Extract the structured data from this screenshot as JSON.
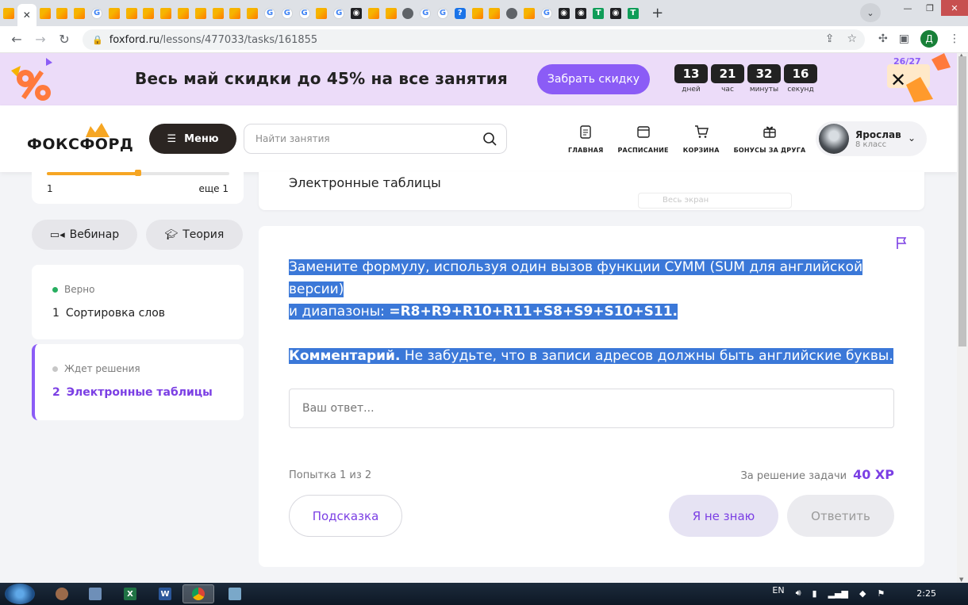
{
  "browser": {
    "tabs": [
      "fox",
      "fox",
      "fox",
      "g",
      "fox",
      "fox",
      "fox",
      "fox",
      "fox",
      "fox",
      "fox",
      "fox",
      "fox",
      "g",
      "g",
      "g",
      "fox",
      "g",
      "dark",
      "fox",
      "fox",
      "globe",
      "g",
      "g",
      "blue",
      "fox",
      "fox",
      "globe",
      "fox",
      "g",
      "dark",
      "dark",
      "green",
      "dark",
      "green"
    ],
    "url_host": "foxford.ru",
    "url_path": "/lessons/477033/tasks/161855",
    "profile_initial": "Д"
  },
  "promo": {
    "text": "Весь май скидки до 45% на все занятия",
    "button": "Забрать скидку",
    "timer": [
      {
        "value": "13",
        "label": "дней"
      },
      {
        "value": "21",
        "label": "час"
      },
      {
        "value": "32",
        "label": "минуты"
      },
      {
        "value": "16",
        "label": "секунд"
      }
    ],
    "badge": "26/27"
  },
  "header": {
    "logo": "ФОКСФОРД",
    "menu": "Меню",
    "search_placeholder": "Найти занятия",
    "nav": [
      "ГЛАВНАЯ",
      "РАСПИСАНИЕ",
      "КОРЗИНА",
      "БОНУСЫ ЗА ДРУГА"
    ],
    "user_name": "Ярослав",
    "user_class": "8 класс"
  },
  "sidebar": {
    "progress_left": "1",
    "progress_right": "еще 1",
    "progress_fraction": 0.5,
    "webinar": "Вебинар",
    "theory": "Теория",
    "tasks": [
      {
        "status": "Верно",
        "status_color": "#27ae60",
        "num": "1",
        "title": "Сортировка слов"
      },
      {
        "status": "Ждет решения",
        "status_color": "#c7c7c7",
        "num": "2",
        "title": "Электронные таблицы"
      }
    ]
  },
  "main": {
    "title": "Электронные таблицы",
    "fullscreen": "Весь экран",
    "question_line1": "Замените формулу, используя один вызов функции СУММ (SUM для английской версии)",
    "question_line2_prefix": "и диапазоны: ",
    "question_formula": "=R8+R9+R10+R11+S8+S9+S10+S11.",
    "comment_label": "Комментарий.",
    "comment_text": " Не забудьте, что в записи адресов должны быть английские буквы.",
    "answer_placeholder": "Ваш ответ...",
    "attempt": "Попытка 1 из 2",
    "reward_label": "За решение задачи",
    "reward_value": "40 XP",
    "hint": "Подсказка",
    "dont_know": "Я не знаю",
    "submit": "Ответить"
  },
  "taskbar": {
    "lang": "EN",
    "time": "2:25"
  }
}
